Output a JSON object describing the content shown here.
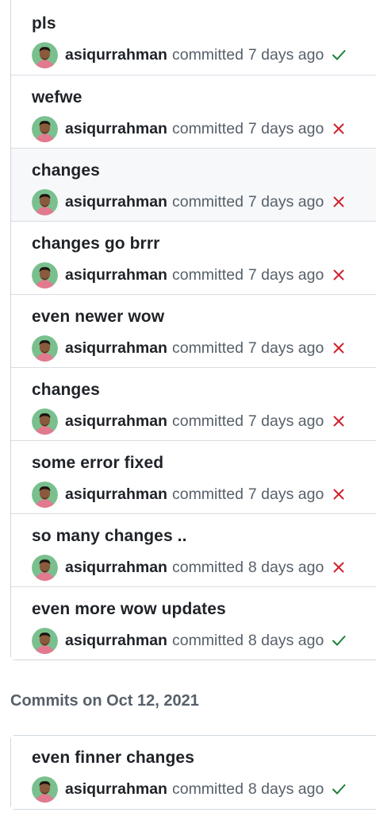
{
  "commit_group": {
    "commits": [
      {
        "title": "pls",
        "author": "asiqurrahman",
        "action": "committed",
        "time": "7 days ago",
        "status": "success"
      },
      {
        "title": "wefwe",
        "author": "asiqurrahman",
        "action": "committed",
        "time": "7 days ago",
        "status": "failure"
      },
      {
        "title": "changes",
        "author": "asiqurrahman",
        "action": "committed",
        "time": "7 days ago",
        "status": "failure"
      },
      {
        "title": "changes go brrr",
        "author": "asiqurrahman",
        "action": "committed",
        "time": "7 days ago",
        "status": "failure"
      },
      {
        "title": "even newer wow",
        "author": "asiqurrahman",
        "action": "committed",
        "time": "7 days ago",
        "status": "failure"
      },
      {
        "title": "changes",
        "author": "asiqurrahman",
        "action": "committed",
        "time": "7 days ago",
        "status": "failure"
      },
      {
        "title": "some error fixed",
        "author": "asiqurrahman",
        "action": "committed",
        "time": "7 days ago",
        "status": "failure"
      },
      {
        "title": "so many changes ..",
        "author": "asiqurrahman",
        "action": "committed",
        "time": "8 days ago",
        "status": "failure"
      },
      {
        "title": "even more wow updates",
        "author": "asiqurrahman",
        "action": "committed",
        "time": "8 days ago",
        "status": "success"
      }
    ]
  },
  "second_group": {
    "heading": "Commits on Oct 12, 2021",
    "commits": [
      {
        "title": "even finner changes",
        "author": "asiqurrahman",
        "action": "committed",
        "time": "8 days ago",
        "status": "success"
      }
    ]
  },
  "colors": {
    "success": "#1a7f37",
    "failure": "#cf222e",
    "muted_text": "#57606a",
    "border": "#d0d7de"
  },
  "icons": {
    "success": "check-icon",
    "failure": "x-icon",
    "avatar": "user-avatar"
  }
}
